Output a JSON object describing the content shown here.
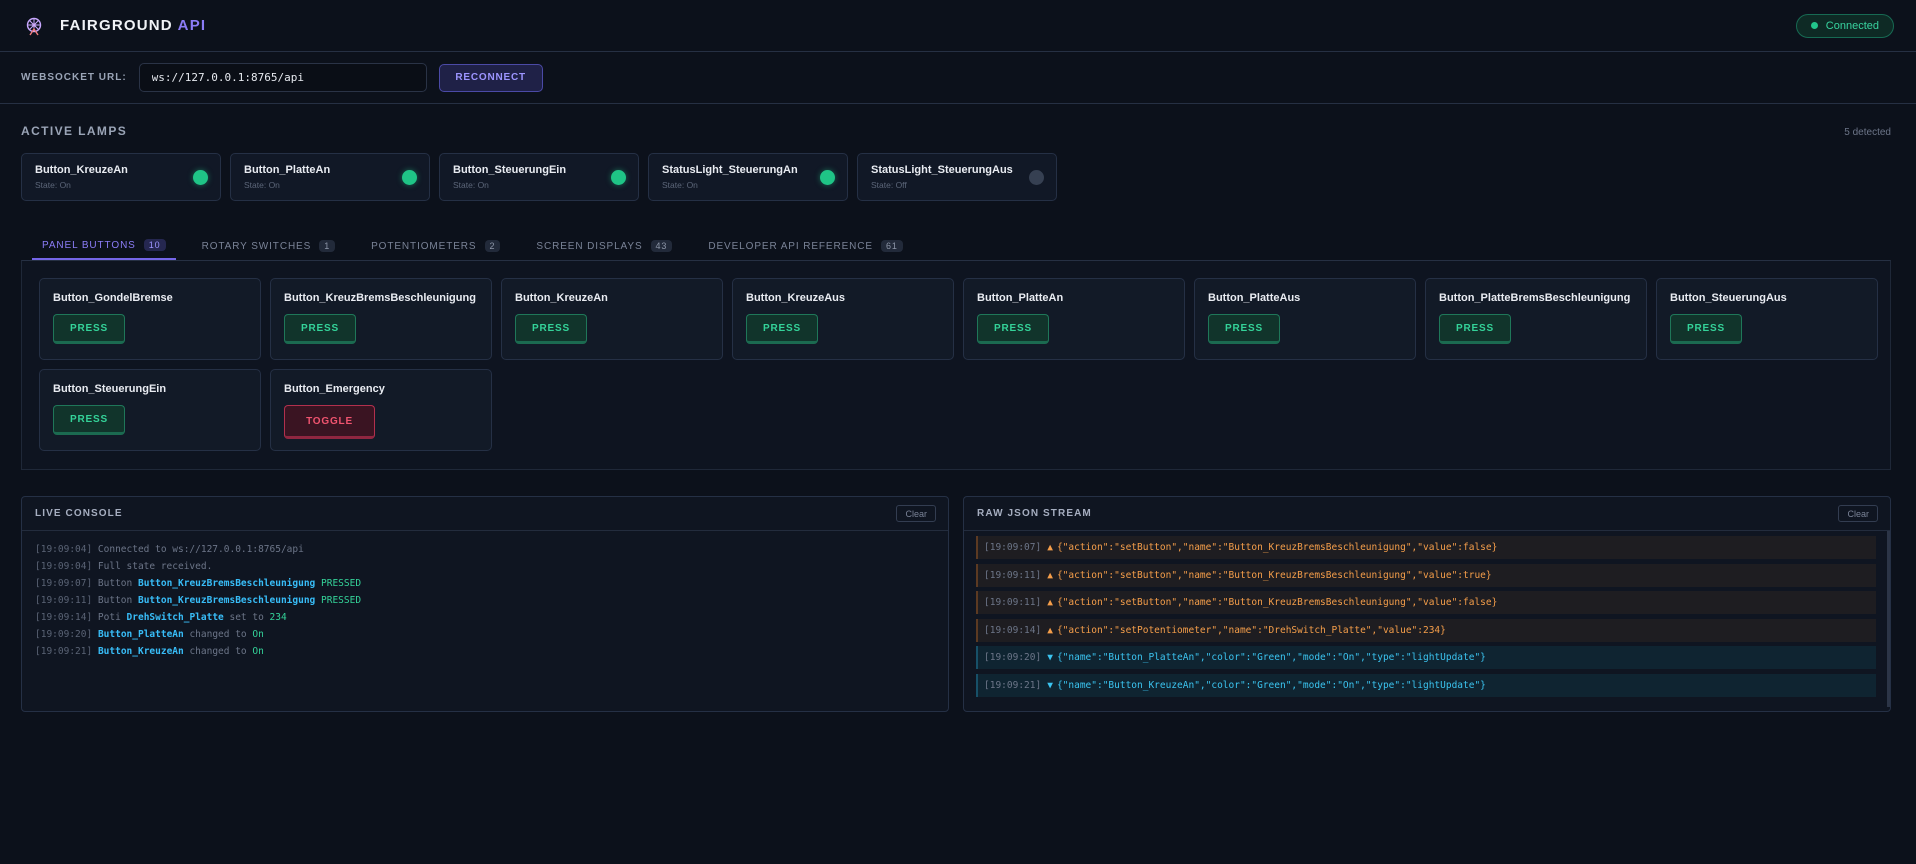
{
  "header": {
    "brand_main": "FAIRGROUND",
    "brand_accent": "API",
    "status": "Connected",
    "status_color": "#22c58b"
  },
  "websocket": {
    "label": "WEBSOCKET URL:",
    "url": "ws://127.0.0.1:8765/api",
    "reconnect_label": "RECONNECT"
  },
  "lamps": {
    "title": "ACTIVE LAMPS",
    "count_text": "5 detected",
    "items": [
      {
        "name": "Button_KreuzeAn",
        "state": "State: On",
        "on": true
      },
      {
        "name": "Button_PlatteAn",
        "state": "State: On",
        "on": true
      },
      {
        "name": "Button_SteuerungEin",
        "state": "State: On",
        "on": true
      },
      {
        "name": "StatusLight_SteuerungAn",
        "state": "State: On",
        "on": true
      },
      {
        "name": "StatusLight_SteuerungAus",
        "state": "State: Off",
        "on": false
      }
    ]
  },
  "tabs": [
    {
      "label": "PANEL BUTTONS",
      "count": "10",
      "active": true
    },
    {
      "label": "ROTARY SWITCHES",
      "count": "1",
      "active": false
    },
    {
      "label": "POTENTIOMETERS",
      "count": "2",
      "active": false
    },
    {
      "label": "SCREEN DISPLAYS",
      "count": "43",
      "active": false
    },
    {
      "label": "DEVELOPER API REFERENCE",
      "count": "61",
      "active": false
    }
  ],
  "buttons": [
    {
      "name": "Button_GondelBremse",
      "action": "PRESS"
    },
    {
      "name": "Button_KreuzBremsBeschleunigung",
      "action": "PRESS"
    },
    {
      "name": "Button_KreuzeAn",
      "action": "PRESS"
    },
    {
      "name": "Button_KreuzeAus",
      "action": "PRESS"
    },
    {
      "name": "Button_PlatteAn",
      "action": "PRESS"
    },
    {
      "name": "Button_PlatteAus",
      "action": "PRESS"
    },
    {
      "name": "Button_PlatteBremsBeschleunigung",
      "action": "PRESS"
    },
    {
      "name": "Button_SteuerungAus",
      "action": "PRESS"
    },
    {
      "name": "Button_SteuerungEin",
      "action": "PRESS"
    },
    {
      "name": "Button_Emergency",
      "action": "TOGGLE"
    }
  ],
  "console": {
    "title": "LIVE CONSOLE",
    "clear_label": "Clear",
    "lines": [
      {
        "ts": "[19:09:04]",
        "parts": [
          {
            "t": " Connected to ws://127.0.0.1:8765/api",
            "c": "plain"
          }
        ]
      },
      {
        "ts": "[19:09:04]",
        "parts": [
          {
            "t": " Full state received.",
            "c": "plain"
          }
        ]
      },
      {
        "ts": "[19:09:07]",
        "parts": [
          {
            "t": " Button ",
            "c": "plain"
          },
          {
            "t": "Button_KreuzBremsBeschleunigung",
            "c": "name"
          },
          {
            "t": " PRESSED",
            "c": "green"
          }
        ]
      },
      {
        "ts": "[19:09:11]",
        "parts": [
          {
            "t": " Button ",
            "c": "plain"
          },
          {
            "t": "Button_KreuzBremsBeschleunigung",
            "c": "name"
          },
          {
            "t": " PRESSED",
            "c": "green"
          }
        ]
      },
      {
        "ts": "[19:09:14]",
        "parts": [
          {
            "t": " Poti ",
            "c": "plain"
          },
          {
            "t": "DrehSwitch_Platte",
            "c": "name"
          },
          {
            "t": " set to ",
            "c": "plain"
          },
          {
            "t": "234",
            "c": "green"
          }
        ]
      },
      {
        "ts": "[19:09:20]",
        "parts": [
          {
            "t": " ",
            "c": "plain"
          },
          {
            "t": "Button_PlatteAn",
            "c": "name"
          },
          {
            "t": " changed to ",
            "c": "plain"
          },
          {
            "t": "On",
            "c": "green"
          }
        ]
      },
      {
        "ts": "[19:09:21]",
        "parts": [
          {
            "t": " ",
            "c": "plain"
          },
          {
            "t": "Button_KreuzeAn",
            "c": "name"
          },
          {
            "t": " changed to ",
            "c": "plain"
          },
          {
            "t": "On",
            "c": "green"
          }
        ]
      }
    ]
  },
  "json_stream": {
    "title": "RAW JSON STREAM",
    "clear_label": "Clear",
    "lines": [
      {
        "ts": "[19:09:07]",
        "dir": "out",
        "arrow": "▲",
        "text": "{\"action\":\"setButton\",\"name\":\"Button_KreuzBremsBeschleunigung\",\"value\":false}"
      },
      {
        "ts": "[19:09:11]",
        "dir": "out",
        "arrow": "▲",
        "text": "{\"action\":\"setButton\",\"name\":\"Button_KreuzBremsBeschleunigung\",\"value\":true}"
      },
      {
        "ts": "[19:09:11]",
        "dir": "out",
        "arrow": "▲",
        "text": "{\"action\":\"setButton\",\"name\":\"Button_KreuzBremsBeschleunigung\",\"value\":false}"
      },
      {
        "ts": "[19:09:14]",
        "dir": "out",
        "arrow": "▲",
        "text": "{\"action\":\"setPotentiometer\",\"name\":\"DrehSwitch_Platte\",\"value\":234}"
      },
      {
        "ts": "[19:09:20]",
        "dir": "in",
        "arrow": "▼",
        "text": "{\"name\":\"Button_PlatteAn\",\"color\":\"Green\",\"mode\":\"On\",\"type\":\"lightUpdate\"}"
      },
      {
        "ts": "[19:09:21]",
        "dir": "in",
        "arrow": "▼",
        "text": "{\"name\":\"Button_KreuzeAn\",\"color\":\"Green\",\"mode\":\"On\",\"type\":\"lightUpdate\"}"
      }
    ]
  }
}
